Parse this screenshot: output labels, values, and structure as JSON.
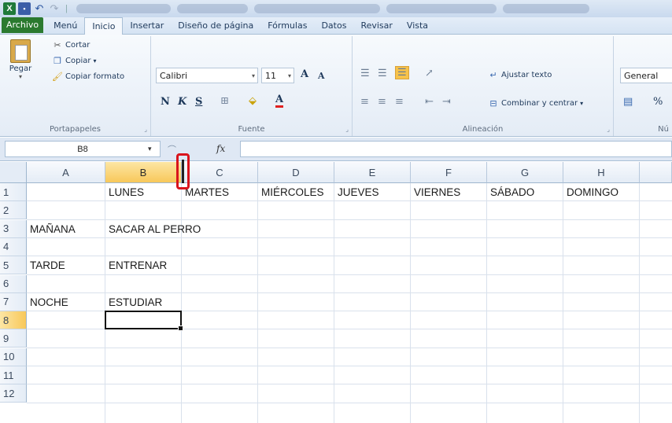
{
  "quick_access": {
    "excel_glyph": "X",
    "undo_glyph": "↶",
    "redo_glyph": "↷",
    "sep": "|"
  },
  "tabs": [
    "Archivo",
    "Menú",
    "Inicio",
    "Insertar",
    "Diseño de página",
    "Fórmulas",
    "Datos",
    "Revisar",
    "Vista"
  ],
  "active_tab": "Inicio",
  "clipboard": {
    "paste": "Pegar",
    "cut": "Cortar",
    "copy": "Copiar",
    "copy_format": "Copiar formato",
    "label": "Portapapeles"
  },
  "font": {
    "name": "Calibri",
    "size": "11",
    "bold": "N",
    "italic": "K",
    "underline": "S",
    "grow": "A",
    "shrink": "A",
    "color_glyph": "A",
    "label": "Fuente"
  },
  "alignment": {
    "wrap_text": "Ajustar texto",
    "merge_center": "Combinar y centrar",
    "label": "Alineación"
  },
  "number": {
    "format": "General",
    "percent": "%",
    "label": "Nú"
  },
  "formula_bar": {
    "name_box": "B8",
    "fx": "fx",
    "value": ""
  },
  "columns": [
    "A",
    "B",
    "C",
    "D",
    "E",
    "F",
    "G",
    "H"
  ],
  "selected_column": "B",
  "rows": [
    "1",
    "2",
    "3",
    "4",
    "5",
    "6",
    "7",
    "8",
    "9",
    "10",
    "11",
    "12"
  ],
  "selected_row": "8",
  "cells": {
    "B1": "LUNES",
    "C1": "MARTES",
    "D1": "MIÉRCOLES",
    "E1": "JUEVES",
    "F1": "VIERNES",
    "G1": "SÁBADO",
    "H1": "DOMINGO",
    "A3": "MAÑANA",
    "B3": "SACAR AL PERRO",
    "A5": "TARDE",
    "B5": "ENTRENAR",
    "A7": "NOCHE",
    "B7": "ESTUDIAR"
  },
  "colors": {
    "accent": "#2b7a2f",
    "marker": "#d9141c",
    "header_selected": "#f8c85a"
  }
}
